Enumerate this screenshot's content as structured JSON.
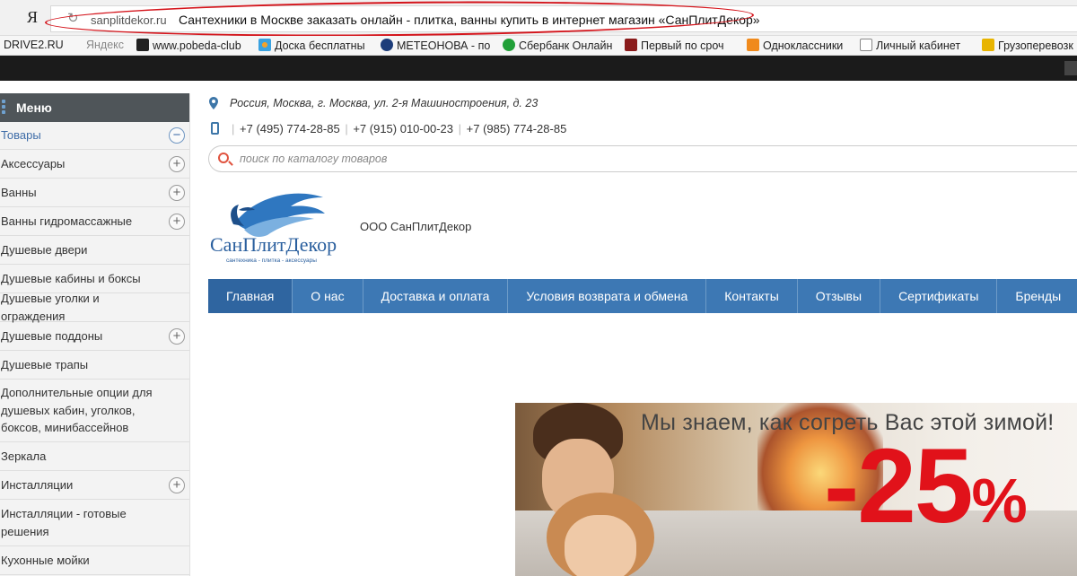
{
  "browser": {
    "yandex_logo": "Я",
    "domain": "sanplitdekor.ru",
    "page_title": "Сантехники в Москве заказать онлайн - плитка, ванны купить в интернет магазин «СанПлитДекор»"
  },
  "bookmarks": [
    {
      "label": "DRIVE2.RU",
      "icon_color": ""
    },
    {
      "label": "Яндекс",
      "icon_color": "#e8342a"
    },
    {
      "label": "www.pobeda-club",
      "icon_color": "#222222"
    },
    {
      "label": "Доска бесплатны",
      "icon_color": "#f0a22c"
    },
    {
      "label": "МЕТЕОНОВА - по",
      "icon_color": "#1d3d7a"
    },
    {
      "label": "Сбербанк Онлайн",
      "icon_color": "#21a038"
    },
    {
      "label": "Первый по сроч",
      "icon_color": "#8a1b1b"
    },
    {
      "label": "Одноклассники",
      "icon_color": "#f08a1c"
    },
    {
      "label": "Личный кабинет",
      "icon_color": "#cccccc"
    },
    {
      "label": "Грузоперевозк",
      "icon_color": "#e8b400"
    }
  ],
  "sidebar": {
    "title": "Меню",
    "categories": [
      {
        "label": "Товары",
        "expand": "−",
        "active": true
      },
      {
        "label": "Аксессуары",
        "expand": "+"
      },
      {
        "label": "Ванны",
        "expand": "+"
      },
      {
        "label": "Ванны гидромассажные",
        "expand": "+"
      },
      {
        "label": "Душевые двери",
        "expand": ""
      },
      {
        "label": "Душевые кабины и боксы",
        "expand": ""
      },
      {
        "label": "Душевые уголки и ограждения",
        "expand": ""
      },
      {
        "label": "Душевые поддоны",
        "expand": "+"
      },
      {
        "label": "Душевые трапы",
        "expand": ""
      },
      {
        "label": "Дополнительные опции для душевых кабин, уголков, боксов, минибассейнов",
        "expand": ""
      },
      {
        "label": "Зеркала",
        "expand": ""
      },
      {
        "label": "Инсталляции",
        "expand": "+"
      },
      {
        "label": "Инсталляции - готовые решения",
        "expand": ""
      },
      {
        "label": "Кухонные мойки",
        "expand": ""
      }
    ]
  },
  "header": {
    "address": "Россия, Москва, г. Москва, ул. 2-я Машиностроения, д. 23",
    "phones": [
      "+7 (495) 774-28-85",
      "+7 (915) 010-00-23",
      "+7 (985) 774-28-85"
    ],
    "search_placeholder": "поиск по каталогу товаров",
    "logo_text": "СанПлитДекор",
    "logo_tagline": "сантехника - плитка - аксессуары",
    "company_name": "ООО СанПлитДекор"
  },
  "nav": [
    "Главная",
    "О нас",
    "Доставка и оплата",
    "Условия возврата и обмена",
    "Контакты",
    "Отзывы",
    "Сертификаты",
    "Бренды"
  ],
  "banner": {
    "slogan": "Мы знаем, как согреть Вас этой зимой!",
    "discount": "-25",
    "percent": "%"
  },
  "colors": {
    "accent": "#3d78b4",
    "nav_active": "#2f65a0",
    "highlight_oval": "#d4141b",
    "discount_red": "#e1121a",
    "menu_head": "#4f5559"
  }
}
